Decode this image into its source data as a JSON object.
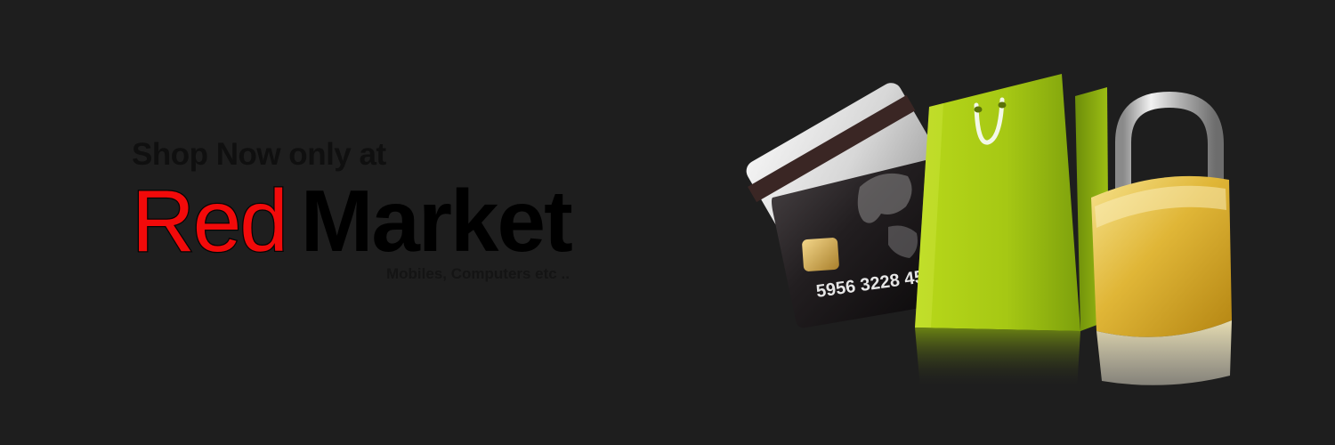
{
  "banner": {
    "tagline": "Shop Now only at",
    "brand_primary": "Red",
    "brand_secondary": "Market",
    "subtitle": "Mobiles, Computers etc ..",
    "card_number": "5956 3228 45"
  },
  "colors": {
    "background": "#1e1e1e",
    "brand_red": "#f20a0a",
    "text_dark": "#0f0f0f",
    "bag_green": "#a8cc12",
    "lock_gold": "#e2b93a"
  },
  "icons": [
    "credit-card-icon",
    "shopping-bag-icon",
    "padlock-icon"
  ]
}
